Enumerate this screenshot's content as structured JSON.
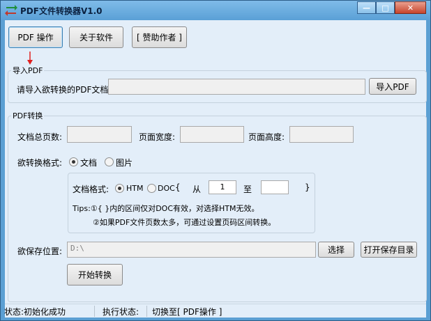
{
  "window": {
    "title": "PDF文件转换器V1.0",
    "controls": {
      "minimize": "—",
      "maximize": "□",
      "close": "✕"
    }
  },
  "toolbar": {
    "pdf_ops": "PDF 操作",
    "about": "关于软件",
    "sponsor": "[ 赞助作者 ]"
  },
  "import_group": {
    "legend": "导入PDF",
    "label": "请导入欲转换的PDF文档:",
    "path_value": "",
    "button": "导入PDF"
  },
  "convert_group": {
    "legend": "PDF转换",
    "total_pages_label": "文档总页数:",
    "total_pages_value": "",
    "page_width_label": "页面宽度:",
    "page_width_value": "",
    "page_height_label": "页面高度:",
    "page_height_value": "",
    "format_label": "欲转换格式:",
    "format_options": {
      "document": "文档",
      "image": "图片"
    },
    "doc_format_label": "文档格式:",
    "doc_format_options": {
      "htm": "HTM",
      "doc": "DOC"
    },
    "range_open": "{",
    "range_from_label": "从",
    "range_from_value": "1",
    "range_to_label": "至",
    "range_to_value": "",
    "range_close": "}",
    "tips_line1": "Tips:①{ }内的区间仅对DOC有效，对选择HTM无效。",
    "tips_line2": "②如果PDF文件页数太多，可通过设置页码区间转换。",
    "save_label": "欲保存位置:",
    "save_path": "D:\\",
    "select_button": "选择",
    "open_dir_button": "打开保存目录",
    "start_button": "开始转换"
  },
  "status_bar": {
    "status": "状态:初始化成功",
    "exec_label": "执行状态:",
    "exec_value": "切换至[ PDF操作 ]"
  },
  "colors": {
    "title_bar": "#5b9fd3",
    "client_bg": "#e3eef9",
    "arrow": "#e02020"
  }
}
